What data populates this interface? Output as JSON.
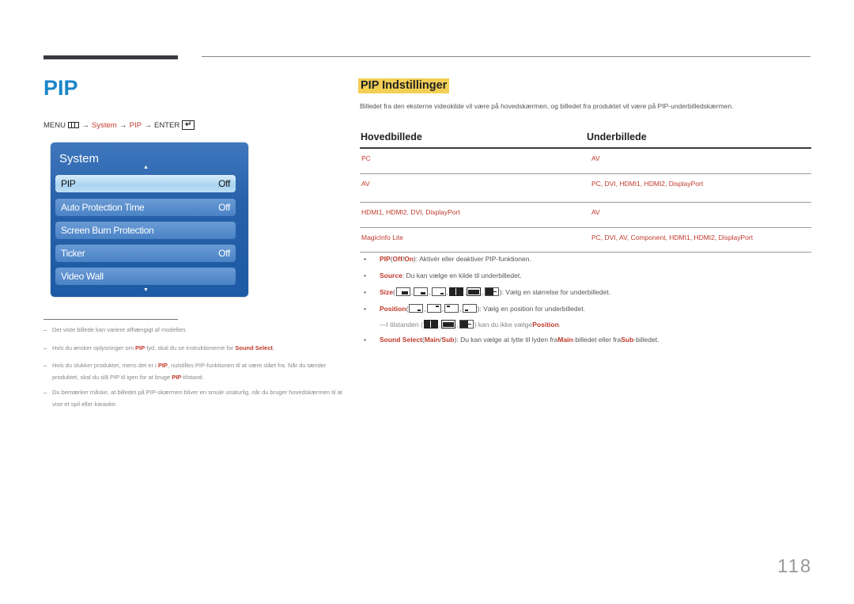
{
  "page": {
    "title": "PIP",
    "page_number": "118"
  },
  "menu_path": {
    "menu": "MENU",
    "menu_icon": "menu-icon",
    "system": "System",
    "pip": "PIP",
    "enter": "ENTER",
    "enter_icon": "enter-icon",
    "arrow": "→"
  },
  "osd": {
    "title": "System",
    "up_arrow": "▲",
    "down_arrow": "▼",
    "items": [
      {
        "label": "PIP",
        "value": "Off",
        "selected": true
      },
      {
        "label": "Auto Protection Time",
        "value": "Off"
      },
      {
        "label": "Screen Burn Protection",
        "value": ""
      },
      {
        "label": "Ticker",
        "value": "Off"
      },
      {
        "label": "Video Wall",
        "value": ""
      }
    ]
  },
  "notes": [
    {
      "dash": "–",
      "parts": [
        "Det viste billede kan variere afhængigt af modellen."
      ]
    },
    {
      "dash": "–",
      "t1": "Hvis du ønsker oplysninger om ",
      "h1": "PIP",
      "t2": "-lyd, skal du se instruktionerne for ",
      "h2": "Sound Select",
      "t3": "."
    },
    {
      "dash": "–",
      "t1": "Hvis du slukker produktet, mens det er i ",
      "h1": "PIP",
      "t2": ", nulstilles PIP-funktionen til at være slået fra. Når du tænder produktet, skal du slå PIP til igen for at bruge ",
      "h2": "PIP",
      "t3": "-tilstand."
    },
    {
      "dash": "–",
      "text": "Du bemærker måske, at billedet på PIP-skærmen bliver en smule unaturlig, når du bruger hovedskærmen til at vise et spil eller karaoke."
    }
  ],
  "section": {
    "title": "PIP Indstillinger",
    "intro": "Billedet fra den eksterne videokilde vil være på hovedskærmen, og billedet fra produktet vil være på PIP-underbilledskærmen."
  },
  "table": {
    "headers": [
      "Hovedbillede",
      "Underbillede"
    ],
    "rows": [
      [
        "PC",
        "AV"
      ],
      [
        "AV",
        "PC, DVI, HDMI1, HDMI2, DisplayPort"
      ],
      [
        "HDMI1, HDMI2, DVI, DisplayPort",
        "AV"
      ],
      [
        "MagicInfo Lite",
        "PC, DVI, AV, Component, HDMI1, HDMI2, DisplayPort"
      ]
    ]
  },
  "bullets": {
    "bullet": "•",
    "pip": {
      "label": "PIP",
      "open": " (",
      "off": "Off",
      "sep": " / ",
      "on": "On",
      "close": ")",
      "desc": ": Aktivér eller deaktiver PIP-funktionen."
    },
    "source": {
      "label": "Source",
      "desc": ": Du kan vælge en kilde til underbilledet."
    },
    "size": {
      "label": "Size",
      "open": " (",
      "close": ")",
      "desc": ": Vælg en størrelse for underbilledet.",
      "icons": [
        "size-large-icon",
        "size-medium-icon",
        "size-small-icon",
        "size-side-by-side-icon",
        "size-side-by-side-small-icon",
        "size-split-icon"
      ]
    },
    "position": {
      "label": "Position",
      "open": " (",
      "close": ")",
      "desc": ": Vælg en position for underbilledet.",
      "icons": [
        "position-bottom-right-icon",
        "position-top-right-icon",
        "position-top-left-icon",
        "position-bottom-left-icon"
      ]
    },
    "subnote": {
      "dash": "—",
      "t1": " I tilstanden (",
      "t2": ") kan du ikke vælge ",
      "h": "Position",
      "t3": "."
    },
    "sound": {
      "label": "Sound Select",
      "open": " (",
      "main": "Main",
      "sep": " / ",
      "sub": "Sub",
      "close": ")",
      "t1": ": Du kan vælge at lytte til lyden fra ",
      "main2": "Main",
      "t2": "-billedet eller fra ",
      "sub2": "Sub",
      "t3": "-billedet."
    }
  }
}
